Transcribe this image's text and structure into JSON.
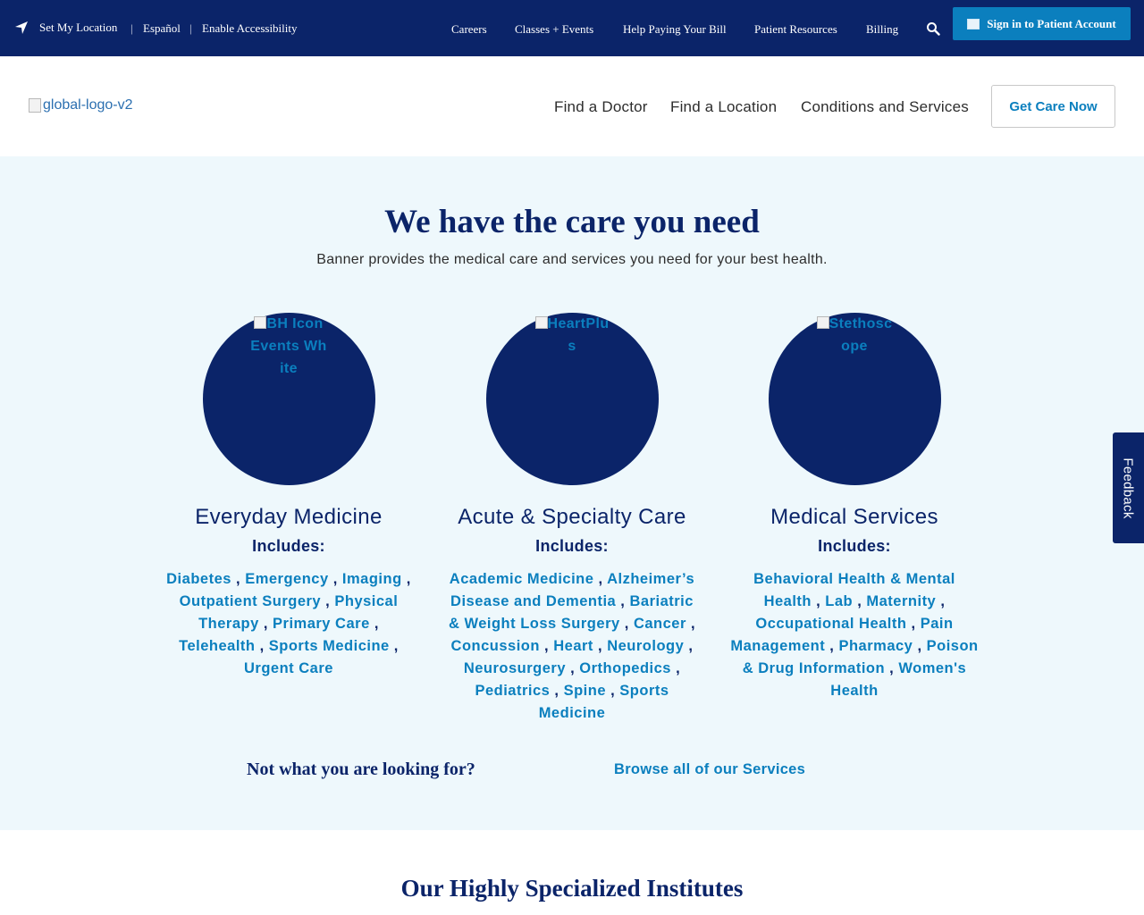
{
  "topbar": {
    "location": "Set My Location",
    "separator": "|",
    "espanol": "Español",
    "accessibility": "Enable Accessibility",
    "nav": [
      "Careers",
      "Classes + Events",
      "Help Paying Your Bill",
      "Patient Resources",
      "Billing"
    ],
    "signin_label": "Sign in to Patient Account"
  },
  "header": {
    "logo_alt": "global-logo-v2",
    "nav": [
      "Find a Doctor",
      "Find a Location",
      "Conditions and Services"
    ],
    "cta": "Get Care Now"
  },
  "care": {
    "title": "We have the care you need",
    "subtitle": "Banner provides the medical care and services you need for your best health.",
    "includes_label": "Includes:",
    "columns": [
      {
        "icon_alt": "BH Icon Events White",
        "title": "Everyday Medicine",
        "links": [
          "Diabetes",
          "Emergency",
          "Imaging",
          "Outpatient Surgery",
          "Physical Therapy",
          "Primary Care",
          "Telehealth",
          "Sports Medicine",
          "Urgent Care"
        ]
      },
      {
        "icon_alt": "HeartPlus",
        "title": "Acute & Specialty Care",
        "links": [
          "Academic Medicine",
          "Alzheimer’s Disease and Dementia",
          "Bariatric & Weight Loss Surgery",
          "Cancer",
          "Concussion",
          "Heart",
          "Neurology",
          "Neurosurgery",
          "Orthopedics",
          "Pediatrics",
          "Spine",
          "Sports Medicine"
        ]
      },
      {
        "icon_alt": "Stethoscope",
        "title": "Medical Services",
        "links": [
          "Behavioral Health & Mental Health",
          "Lab",
          "Maternity",
          "Occupational Health",
          "Pain Management",
          "Pharmacy",
          "Poison & Drug Information",
          "Women's Health"
        ]
      }
    ],
    "not_what": "Not what you are looking for?",
    "browse": "Browse all of our Services"
  },
  "institutes_title": "Our Highly Specialized Institutes",
  "feedback": "Feedback",
  "colors": {
    "navy": "#0b2469",
    "link_blue": "#0b7fbe",
    "section_bg": "#eef8fc"
  }
}
